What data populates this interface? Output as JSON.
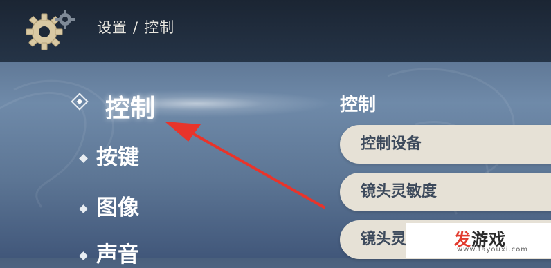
{
  "header": {
    "breadcrumb_parent": "设置",
    "breadcrumb_separator": "/",
    "breadcrumb_current": "控制"
  },
  "menu": {
    "items": [
      {
        "label": "控制",
        "active": true
      },
      {
        "label": "按键",
        "active": false
      },
      {
        "label": "图像",
        "active": false
      },
      {
        "label": "声音",
        "active": false
      }
    ]
  },
  "panel": {
    "section_title": "控制",
    "settings": [
      {
        "label": "控制设备"
      },
      {
        "label": "镜头灵敏度"
      },
      {
        "label": "镜头灵"
      }
    ]
  },
  "watermark": {
    "logo_accent": "发",
    "logo_rest": "游戏",
    "url": "www.fayouxi.com"
  },
  "colors": {
    "arrow": "#e8342b",
    "row_bg": "#e6e1d6",
    "topbar": "#1b2533"
  },
  "icons": {
    "settings": "gear-icon",
    "selected_marker": "diamond-selected-icon",
    "menu_marker": "diamond-icon"
  }
}
